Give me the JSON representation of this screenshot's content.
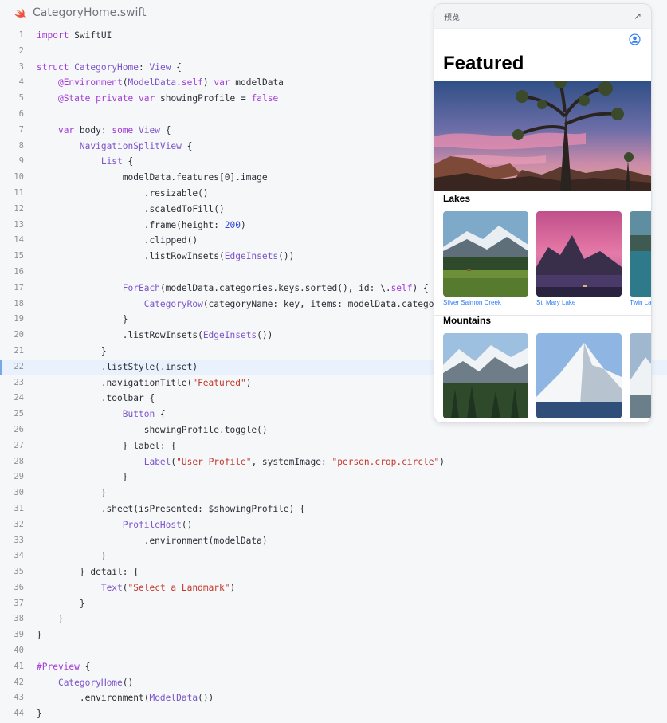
{
  "editor": {
    "file_name": "CategoryHome.swift",
    "current_line": 22,
    "lines": [
      {
        "n": "1",
        "tokens": [
          [
            "kw",
            "import"
          ],
          [
            "pl",
            " SwiftUI"
          ]
        ]
      },
      {
        "n": "2",
        "tokens": []
      },
      {
        "n": "3",
        "tokens": [
          [
            "kw",
            "struct"
          ],
          [
            "pl",
            " "
          ],
          [
            "ty",
            "CategoryHome"
          ],
          [
            "pl",
            ": "
          ],
          [
            "ty",
            "View"
          ],
          [
            "pl",
            " {"
          ]
        ]
      },
      {
        "n": "4",
        "tokens": [
          [
            "pl",
            "    "
          ],
          [
            "kw",
            "@Environment"
          ],
          [
            "pl",
            "("
          ],
          [
            "ty",
            "ModelData"
          ],
          [
            "pl",
            "."
          ],
          [
            "kw",
            "self"
          ],
          [
            "pl",
            ") "
          ],
          [
            "kw",
            "var"
          ],
          [
            "pl",
            " modelData"
          ]
        ]
      },
      {
        "n": "5",
        "tokens": [
          [
            "pl",
            "    "
          ],
          [
            "kw",
            "@State"
          ],
          [
            "pl",
            " "
          ],
          [
            "kw",
            "private"
          ],
          [
            "pl",
            " "
          ],
          [
            "kw",
            "var"
          ],
          [
            "pl",
            " showingProfile = "
          ],
          [
            "kw",
            "false"
          ]
        ]
      },
      {
        "n": "6",
        "tokens": []
      },
      {
        "n": "7",
        "tokens": [
          [
            "pl",
            "    "
          ],
          [
            "kw",
            "var"
          ],
          [
            "pl",
            " body: "
          ],
          [
            "kw",
            "some"
          ],
          [
            "pl",
            " "
          ],
          [
            "ty",
            "View"
          ],
          [
            "pl",
            " {"
          ]
        ]
      },
      {
        "n": "8",
        "tokens": [
          [
            "pl",
            "        "
          ],
          [
            "ty",
            "NavigationSplitView"
          ],
          [
            "pl",
            " {"
          ]
        ]
      },
      {
        "n": "9",
        "tokens": [
          [
            "pl",
            "            "
          ],
          [
            "ty",
            "List"
          ],
          [
            "pl",
            " {"
          ]
        ]
      },
      {
        "n": "10",
        "tokens": [
          [
            "pl",
            "                modelData.features[0].image"
          ]
        ]
      },
      {
        "n": "11",
        "tokens": [
          [
            "pl",
            "                    .resizable()"
          ]
        ]
      },
      {
        "n": "12",
        "tokens": [
          [
            "pl",
            "                    .scaledToFill()"
          ]
        ]
      },
      {
        "n": "13",
        "tokens": [
          [
            "pl",
            "                    .frame(height: "
          ],
          [
            "nu",
            "200"
          ],
          [
            "pl",
            ")"
          ]
        ]
      },
      {
        "n": "14",
        "tokens": [
          [
            "pl",
            "                    .clipped()"
          ]
        ]
      },
      {
        "n": "15",
        "tokens": [
          [
            "pl",
            "                    .listRowInsets("
          ],
          [
            "ty",
            "EdgeInsets"
          ],
          [
            "pl",
            "())"
          ]
        ]
      },
      {
        "n": "16",
        "tokens": []
      },
      {
        "n": "17",
        "tokens": [
          [
            "pl",
            "                "
          ],
          [
            "ty",
            "ForEach"
          ],
          [
            "pl",
            "(modelData.categories.keys.sorted(), id: \\."
          ],
          [
            "kw",
            "self"
          ],
          [
            "pl",
            ") { key "
          ],
          [
            "kw",
            "in"
          ]
        ]
      },
      {
        "n": "18",
        "tokens": [
          [
            "pl",
            "                    "
          ],
          [
            "ty",
            "CategoryRow"
          ],
          [
            "pl",
            "(categoryName: key, items: modelData.categories[key]!)"
          ]
        ]
      },
      {
        "n": "19",
        "tokens": [
          [
            "pl",
            "                }"
          ]
        ]
      },
      {
        "n": "20",
        "tokens": [
          [
            "pl",
            "                .listRowInsets("
          ],
          [
            "ty",
            "EdgeInsets"
          ],
          [
            "pl",
            "())"
          ]
        ]
      },
      {
        "n": "21",
        "tokens": [
          [
            "pl",
            "            }"
          ]
        ]
      },
      {
        "n": "22",
        "tokens": [
          [
            "pl",
            "            .listStyle(.inset)"
          ]
        ]
      },
      {
        "n": "23",
        "tokens": [
          [
            "pl",
            "            .navigationTitle("
          ],
          [
            "st",
            "\"Featured\""
          ],
          [
            "pl",
            ")"
          ]
        ]
      },
      {
        "n": "24",
        "tokens": [
          [
            "pl",
            "            .toolbar {"
          ]
        ]
      },
      {
        "n": "25",
        "tokens": [
          [
            "pl",
            "                "
          ],
          [
            "ty",
            "Button"
          ],
          [
            "pl",
            " {"
          ]
        ]
      },
      {
        "n": "26",
        "tokens": [
          [
            "pl",
            "                    showingProfile.toggle()"
          ]
        ]
      },
      {
        "n": "27",
        "tokens": [
          [
            "pl",
            "                } label: {"
          ]
        ]
      },
      {
        "n": "28",
        "tokens": [
          [
            "pl",
            "                    "
          ],
          [
            "ty",
            "Label"
          ],
          [
            "pl",
            "("
          ],
          [
            "st",
            "\"User Profile\""
          ],
          [
            "pl",
            ", systemImage: "
          ],
          [
            "st",
            "\"person.crop.circle\""
          ],
          [
            "pl",
            ")"
          ]
        ]
      },
      {
        "n": "29",
        "tokens": [
          [
            "pl",
            "                }"
          ]
        ]
      },
      {
        "n": "30",
        "tokens": [
          [
            "pl",
            "            }"
          ]
        ]
      },
      {
        "n": "31",
        "tokens": [
          [
            "pl",
            "            .sheet(isPresented: $showingProfile) {"
          ]
        ]
      },
      {
        "n": "32",
        "tokens": [
          [
            "pl",
            "                "
          ],
          [
            "ty",
            "ProfileHost"
          ],
          [
            "pl",
            "()"
          ]
        ]
      },
      {
        "n": "33",
        "tokens": [
          [
            "pl",
            "                    .environment(modelData)"
          ]
        ]
      },
      {
        "n": "34",
        "tokens": [
          [
            "pl",
            "            }"
          ]
        ]
      },
      {
        "n": "35",
        "tokens": [
          [
            "pl",
            "        } detail: {"
          ]
        ]
      },
      {
        "n": "36",
        "tokens": [
          [
            "pl",
            "            "
          ],
          [
            "ty",
            "Text"
          ],
          [
            "pl",
            "("
          ],
          [
            "st",
            "\"Select a Landmark\""
          ],
          [
            "pl",
            ")"
          ]
        ]
      },
      {
        "n": "37",
        "tokens": [
          [
            "pl",
            "        }"
          ]
        ]
      },
      {
        "n": "38",
        "tokens": [
          [
            "pl",
            "    }"
          ]
        ]
      },
      {
        "n": "39",
        "tokens": [
          [
            "pl",
            "}"
          ]
        ]
      },
      {
        "n": "40",
        "tokens": []
      },
      {
        "n": "41",
        "tokens": [
          [
            "kw",
            "#Preview"
          ],
          [
            "pl",
            " {"
          ]
        ]
      },
      {
        "n": "42",
        "tokens": [
          [
            "pl",
            "    "
          ],
          [
            "ty",
            "CategoryHome"
          ],
          [
            "pl",
            "()"
          ]
        ]
      },
      {
        "n": "43",
        "tokens": [
          [
            "pl",
            "        .environment("
          ],
          [
            "ty",
            "ModelData"
          ],
          [
            "pl",
            "())"
          ]
        ]
      },
      {
        "n": "44",
        "tokens": [
          [
            "pl",
            "}"
          ]
        ]
      }
    ]
  },
  "preview": {
    "panel_title": "预览",
    "expand_icon": "arrow-up-right-icon",
    "nav_title": "Featured",
    "profile_icon": "person-crop-circle-icon",
    "categories": [
      {
        "name": "Lakes",
        "items": [
          "Silver Salmon Creek",
          "St. Mary Lake",
          "Twin Lake"
        ]
      },
      {
        "name": "Mountains",
        "items": [
          "",
          "",
          ""
        ]
      }
    ]
  },
  "colors": {
    "keyword": "#a23bd6",
    "type": "#7d54c9",
    "string": "#c4372c",
    "number": "#2f48d6",
    "accent": "#2f7cf6",
    "swift_orange": "#f05138"
  }
}
